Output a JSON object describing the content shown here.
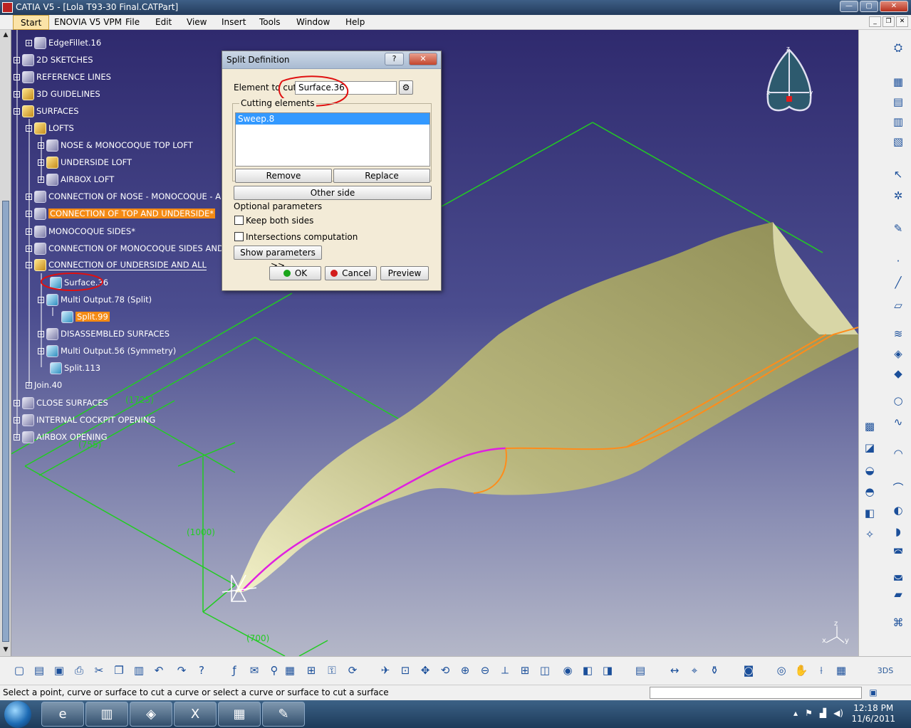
{
  "window": {
    "title": "CATIA V5 - [Lola T93-30 Final.CATPart]",
    "minimize": "—",
    "maximize": "▢",
    "close": "✕"
  },
  "menu": {
    "start": "Start",
    "enovia": "ENOVIA V5 VPM",
    "file": "File",
    "edit": "Edit",
    "view": "View",
    "insert": "Insert",
    "tools": "Tools",
    "window": "Window",
    "help": "Help"
  },
  "tree": [
    {
      "label": "EdgeFillet.16",
      "icon": "fillet-icon"
    },
    {
      "label": "2D SKETCHES",
      "icon": "geometric-set-icon"
    },
    {
      "label": "REFERENCE LINES",
      "icon": "geometric-set-icon"
    },
    {
      "label": "3D GUIDELINES",
      "icon": "geometric-set-icon"
    },
    {
      "label": "SURFACES",
      "icon": "geometric-set-icon"
    },
    {
      "label": "LOFTS",
      "icon": "geometric-set-icon"
    },
    {
      "label": "NOSE & MONOCOQUE TOP LOFT",
      "icon": "geometric-set-icon"
    },
    {
      "label": "UNDERSIDE LOFT",
      "icon": "geometric-set-icon"
    },
    {
      "label": "AIRBOX LOFT",
      "icon": "geometric-set-icon"
    },
    {
      "label": "CONNECTION OF NOSE - MONOCOQUE - AIRB",
      "icon": "geometric-set-icon"
    },
    {
      "label": "CONNECTION OF TOP AND UNDERSIDE*",
      "icon": "geometric-set-icon"
    },
    {
      "label": "MONOCOQUE SIDES*",
      "icon": "geometric-set-icon"
    },
    {
      "label": "CONNECTION OF MONOCOQUE SIDES AND FRO",
      "icon": "geometric-set-icon"
    },
    {
      "label": "CONNECTION OF UNDERSIDE AND ALL",
      "icon": "geometric-set-icon"
    },
    {
      "label": "Surface.36",
      "icon": "surface-icon"
    },
    {
      "label": "Multi Output.78 (Split)",
      "icon": "multi-output-icon"
    },
    {
      "label": "Split.99",
      "icon": "split-icon"
    },
    {
      "label": "DISASSEMBLED SURFACES",
      "icon": "geometric-set-icon"
    },
    {
      "label": "Multi Output.56 (Symmetry)",
      "icon": "multi-output-icon"
    },
    {
      "label": "Split.113",
      "icon": "split-icon"
    },
    {
      "label": "Join.40",
      "icon": "join-icon"
    },
    {
      "label": "CLOSE SURFACES",
      "icon": "geometric-set-icon"
    },
    {
      "label": "INTERNAL COCKPIT OPENING",
      "icon": "geometric-set-icon"
    },
    {
      "label": "AIRBOX OPENING",
      "icon": "geometric-set-icon"
    }
  ],
  "dialog": {
    "title": "Split Definition",
    "help": "?",
    "close": "✕",
    "element_label": "Element to cut:",
    "element_value": "Surface.36",
    "cutting_label": "Cutting elements",
    "cutting_items": [
      "Sweep.8"
    ],
    "remove": "Remove",
    "replace": "Replace",
    "other_side": "Other side",
    "optional": "Optional parameters",
    "keep_both": "Keep both sides",
    "intersections": "Intersections computation",
    "show_params": "Show parameters >>",
    "ok": "OK",
    "cancel": "Cancel",
    "preview": "Preview"
  },
  "dimensions": {
    "d1": "(1725)",
    "d2": "(755)",
    "d3": "(1000)",
    "d4": "(700)"
  },
  "compass": {
    "z": "z",
    "x": "x",
    "y": "y"
  },
  "axis": {
    "z": "z",
    "x": "x",
    "y": "y"
  },
  "status": {
    "prompt": "Select a point, curve or surface to cut a curve or select a curve or surface to cut a surface"
  },
  "clock": {
    "time": "12:18 PM",
    "date": "11/6/2011"
  },
  "colors": {
    "highlight": "#f48a14",
    "dimension": "#22cc22",
    "surface": "#c9c58a",
    "split_curve": "#e020e0"
  }
}
